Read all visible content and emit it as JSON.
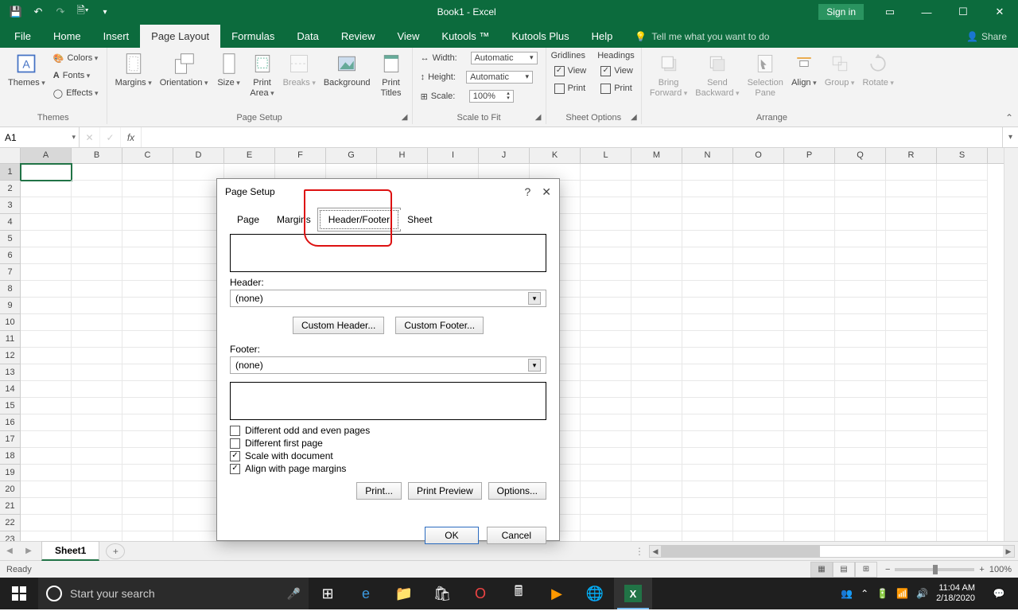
{
  "app": {
    "title": "Book1  -  Excel",
    "signin": "Sign in"
  },
  "tabs": [
    "File",
    "Home",
    "Insert",
    "Page Layout",
    "Formulas",
    "Data",
    "Review",
    "View",
    "Kutools ™",
    "Kutools Plus",
    "Help"
  ],
  "active_tab": "Page Layout",
  "tellme": "Tell me what you want to do",
  "share": "Share",
  "ribbon": {
    "themes": {
      "label": "Themes",
      "themes": "Themes",
      "colors": "Colors",
      "fonts": "Fonts",
      "effects": "Effects"
    },
    "pagesetup": {
      "label": "Page Setup",
      "margins": "Margins",
      "orientation": "Orientation",
      "size": "Size",
      "printarea": "Print\nArea",
      "breaks": "Breaks",
      "background": "Background",
      "printtitles": "Print\nTitles"
    },
    "scale": {
      "label": "Scale to Fit",
      "width": "Width:",
      "height": "Height:",
      "scale": "Scale:",
      "width_val": "Automatic",
      "height_val": "Automatic",
      "scale_val": "100%"
    },
    "sheetopts": {
      "label": "Sheet Options",
      "gridlines": "Gridlines",
      "headings": "Headings",
      "view": "View",
      "print": "Print"
    },
    "arrange": {
      "label": "Arrange",
      "bringfwd": "Bring\nForward",
      "sendback": "Send\nBackward",
      "selpane": "Selection\nPane",
      "align": "Align",
      "group": "Group",
      "rotate": "Rotate"
    }
  },
  "namebox": "A1",
  "columns": [
    "A",
    "B",
    "C",
    "D",
    "E",
    "F",
    "G",
    "H",
    "I",
    "J",
    "K",
    "L",
    "M",
    "N",
    "O",
    "P",
    "Q",
    "R",
    "S"
  ],
  "rows": [
    1,
    2,
    3,
    4,
    5,
    6,
    7,
    8,
    9,
    10,
    11,
    12,
    13,
    14,
    15,
    16,
    17,
    18,
    19,
    20,
    21,
    22,
    23
  ],
  "sheet_tab": "Sheet1",
  "status": {
    "ready": "Ready",
    "zoom": "100%"
  },
  "dialog": {
    "title": "Page Setup",
    "tabs": [
      "Page",
      "Margins",
      "Header/Footer",
      "Sheet"
    ],
    "active_tab": "Header/Footer",
    "header_label": "Header:",
    "footer_label": "Footer:",
    "header_value": "(none)",
    "footer_value": "(none)",
    "custom_header": "Custom Header...",
    "custom_footer": "Custom Footer...",
    "chk_diff_odd": "Different odd and even pages",
    "chk_diff_first": "Different first page",
    "chk_scale": "Scale with document",
    "chk_align": "Align with page margins",
    "print": "Print...",
    "preview": "Print Preview",
    "options": "Options...",
    "ok": "OK",
    "cancel": "Cancel"
  },
  "taskbar": {
    "search_placeholder": "Start your search",
    "time": "11:04 AM",
    "date": "2/18/2020"
  }
}
